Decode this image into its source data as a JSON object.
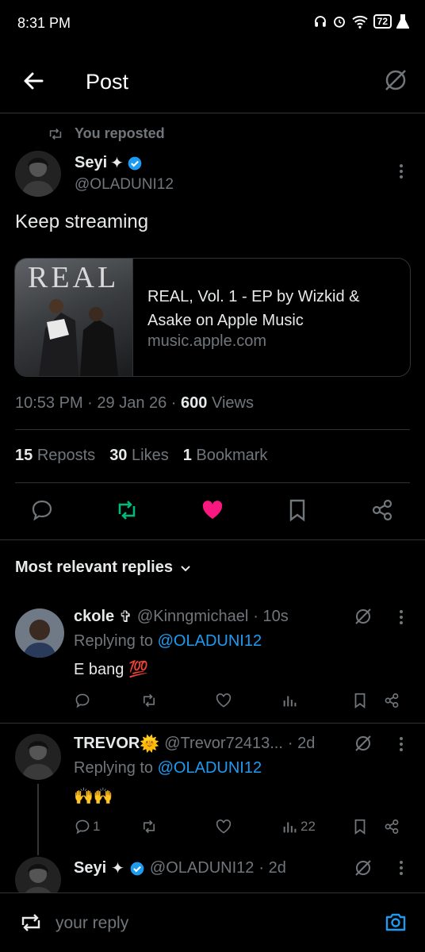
{
  "status_bar": {
    "time": "8:31 PM",
    "battery": "72"
  },
  "header": {
    "title": "Post"
  },
  "post": {
    "repost_label": "You reposted",
    "author_name": "Seyi",
    "author_handle": "@OLADUNI12",
    "text": "Keep streaming",
    "card": {
      "image_word": "REAL",
      "title": "REAL, Vol. 1 - EP by Wizkid & Asake on Apple Music",
      "domain": "music.apple.com"
    },
    "time": "10:53 PM",
    "date": "29 Jan 26",
    "views_count": "600",
    "views_label": "Views",
    "reposts_count": "15",
    "reposts_label": "Reposts",
    "likes_count": "30",
    "likes_label": "Likes",
    "bookmarks_count": "1",
    "bookmarks_label": "Bookmark"
  },
  "replies_header": "Most relevant replies",
  "replies": [
    {
      "name": "ckole",
      "name_suffix": "✞",
      "handle": "@Kinngmichael",
      "age": "· 10s",
      "replying_prefix": "Replying to",
      "replying_handle": "@OLADUNI12",
      "text": "E bang",
      "emoji": "💯",
      "reply_count": "",
      "view_count": ""
    },
    {
      "name": "TREVOR",
      "name_suffix": "🌞",
      "handle": "@Trevor72413...",
      "age": "· 2d",
      "replying_prefix": "Replying to",
      "replying_handle": "@OLADUNI12",
      "text": "",
      "emoji": "🙌🙌",
      "reply_count": "1",
      "view_count": "22"
    },
    {
      "name": "Seyi",
      "handle": "@OLADUNI12",
      "age": "· 2d"
    }
  ],
  "compose": {
    "placeholder": "your reply"
  },
  "colors": {
    "accent": "#1d9bf0",
    "like": "#f91880",
    "repost": "#00ba7c",
    "muted": "#71767b"
  }
}
